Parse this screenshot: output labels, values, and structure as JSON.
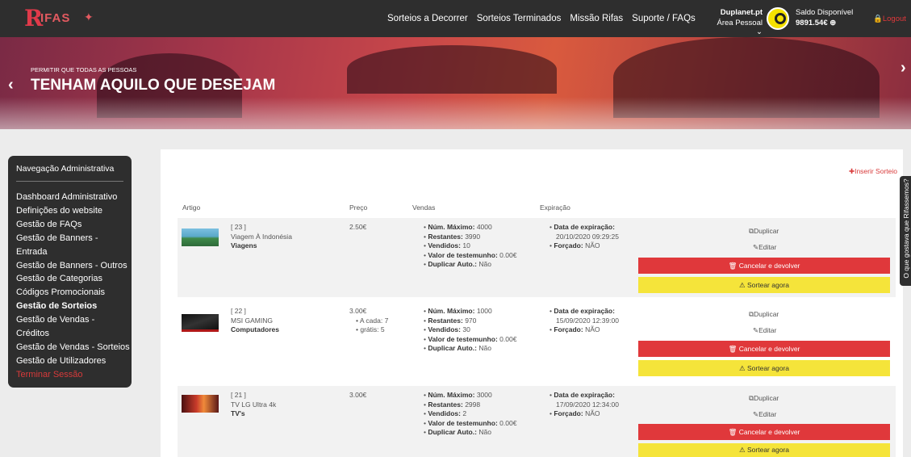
{
  "brand": {
    "logo_text": "RIFAS"
  },
  "nav": {
    "links": [
      "Sorteios a Decorrer",
      "Sorteios Terminados",
      "Missão Rifas",
      "Suporte / FAQs"
    ]
  },
  "account": {
    "name": "Duplanet.pt",
    "area": "Área Pessoal ⌄",
    "balance_label": "Saldo Disponível",
    "balance_value": "9891.54€ ⊕",
    "logout": "Logout"
  },
  "banner": {
    "subtitle": "PERMITIR QUE TODAS AS PESSOAS",
    "title": "TENHAM AQUILO QUE DESEJAM"
  },
  "sidebar": {
    "heading": "Navegação Administrativa",
    "items": [
      "Dashboard Administrativo",
      "Definições do website",
      "Gestão de FAQs",
      "Gestão de Banners -",
      "Entrada",
      "Gestão de Banners - Outros",
      "Gestão de Categorias",
      "Códigos Promocionais",
      "Gestão de Sorteios",
      "Gestão de Vendas -",
      "Créditos",
      "Gestão de Vendas - Sorteios",
      "Gestão de Utilizadores",
      "Terminar Sessão"
    ]
  },
  "table": {
    "insert_label": "Inserir Sorteio",
    "headers": {
      "article": "Artigo",
      "price": "Preço",
      "sales": "Vendas",
      "expiry": "Expiração"
    },
    "actions": {
      "duplicate": "Duplicar",
      "edit": "Editar",
      "cancel": "Cancelar e devolver",
      "draw": "Sortear agora"
    },
    "rows": [
      {
        "id": "[ 23 ]",
        "name": "Viagem À Indonésia",
        "category": "Viagens",
        "price": "2.50€",
        "price_sub": [],
        "max_label": "Núm. Máximo:",
        "max": "4000",
        "left_label": "Restantes:",
        "left": "3990",
        "sold_label": "Vendidos:",
        "sold": "10",
        "testimony_label": "Valor de testemunho:",
        "testimony": "0.00€",
        "dup_label": "Duplicar Auto.:",
        "dup": "Não",
        "exp_label": "Data de expiração:",
        "exp": "20/10/2020 09:29:25",
        "forced_label": "Forçado:",
        "forced": "NÃO"
      },
      {
        "id": "[ 22 ]",
        "name": "MSI GAMING",
        "category": "Computadores",
        "price": "3.00€",
        "price_sub": [
          "A cada: 7",
          "grátis: 5"
        ],
        "max_label": "Núm. Máximo:",
        "max": "1000",
        "left_label": "Restantes:",
        "left": "970",
        "sold_label": "Vendidos:",
        "sold": "30",
        "testimony_label": "Valor de testemunho:",
        "testimony": "0.00€",
        "dup_label": "Duplicar Auto.:",
        "dup": "Não",
        "exp_label": "Data de expiração:",
        "exp": "15/09/2020 12:39:00",
        "forced_label": "Forçado:",
        "forced": "NÃO"
      },
      {
        "id": "[ 21 ]",
        "name": "TV LG Ultra 4k",
        "category": "TV's",
        "price": "3.00€",
        "price_sub": [],
        "max_label": "Núm. Máximo:",
        "max": "3000",
        "left_label": "Restantes:",
        "left": "2998",
        "sold_label": "Vendidos:",
        "sold": "2",
        "testimony_label": "Valor de testemunho:",
        "testimony": "0.00€",
        "dup_label": "Duplicar Auto.:",
        "dup": "Não",
        "exp_label": "Data de expiração:",
        "exp": "17/09/2020 12:34:00",
        "forced_label": "Forçado:",
        "forced": "NÃO"
      }
    ]
  },
  "side_tab": {
    "label": "O que gostava que Rifassemos?"
  },
  "colors": {
    "accent_red": "#e0383b",
    "accent_yellow": "#f5e43a",
    "dark": "#2e2e2e"
  }
}
